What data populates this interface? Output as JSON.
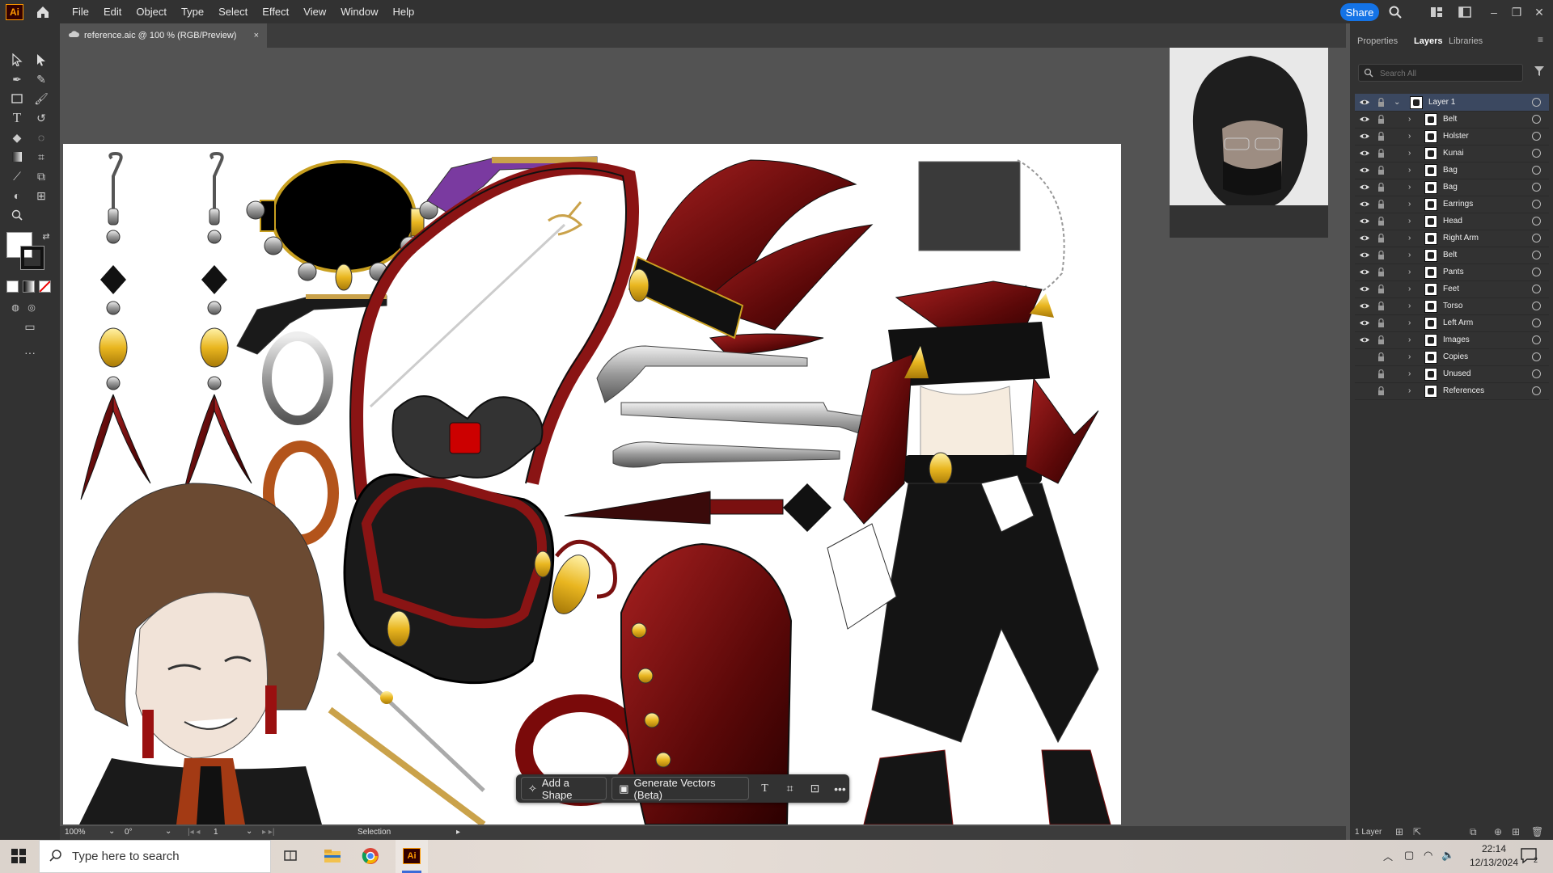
{
  "app": {
    "logo": "Ai"
  },
  "menu": [
    "File",
    "Edit",
    "Object",
    "Type",
    "Select",
    "Effect",
    "View",
    "Window",
    "Help"
  ],
  "header": {
    "share_label": "Share"
  },
  "document": {
    "tab_title": "reference.aic @ 100 % (RGB/Preview)",
    "close": "×"
  },
  "panel": {
    "tabs": [
      "Properties",
      "Layers",
      "Libraries"
    ],
    "search_placeholder": "Search All",
    "layers": [
      {
        "name": "Layer 1",
        "visible": true
      },
      {
        "name": "Belt",
        "visible": true
      },
      {
        "name": "Holster",
        "visible": true
      },
      {
        "name": "Kunai",
        "visible": true
      },
      {
        "name": "Bag",
        "visible": true
      },
      {
        "name": "Bag",
        "visible": true
      },
      {
        "name": "Earrings",
        "visible": true
      },
      {
        "name": "Head",
        "visible": true
      },
      {
        "name": "Right Arm",
        "visible": true
      },
      {
        "name": "Belt",
        "visible": true
      },
      {
        "name": "Pants",
        "visible": true
      },
      {
        "name": "Feet",
        "visible": true
      },
      {
        "name": "Torso",
        "visible": true
      },
      {
        "name": "Left Arm",
        "visible": true
      },
      {
        "name": "Images",
        "visible": true
      },
      {
        "name": "Copies",
        "visible": false
      },
      {
        "name": "Unused",
        "visible": false
      },
      {
        "name": "References",
        "visible": false
      }
    ],
    "layer_count": "1 Layer"
  },
  "context_bar": {
    "add_shape": "Add a Shape",
    "generate_vectors": "Generate Vectors (Beta)"
  },
  "status": {
    "zoom": "100%",
    "rotation": "0°",
    "artboard": "1",
    "tool": "Selection"
  },
  "taskbar": {
    "search_placeholder": "Type here to search",
    "time": "22:14",
    "date": "12/13/2024",
    "notifications": "2"
  },
  "colors": {
    "accent": "#1473e6",
    "maroon": "#6b0f0f",
    "gold": "#e9b620"
  }
}
